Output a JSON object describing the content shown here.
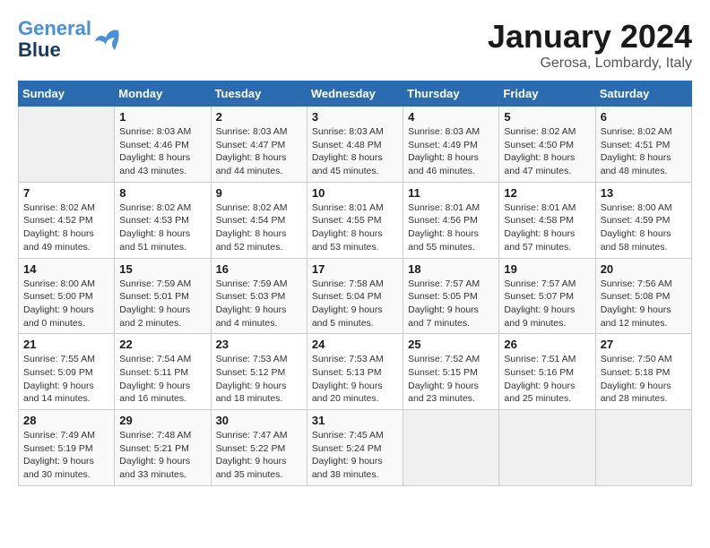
{
  "header": {
    "logo": {
      "line1": "General",
      "line2": "Blue"
    },
    "title": "January 2024",
    "subtitle": "Gerosa, Lombardy, Italy"
  },
  "weekdays": [
    "Sunday",
    "Monday",
    "Tuesday",
    "Wednesday",
    "Thursday",
    "Friday",
    "Saturday"
  ],
  "weeks": [
    [
      {
        "day": "",
        "info": ""
      },
      {
        "day": "1",
        "info": "Sunrise: 8:03 AM\nSunset: 4:46 PM\nDaylight: 8 hours\nand 43 minutes."
      },
      {
        "day": "2",
        "info": "Sunrise: 8:03 AM\nSunset: 4:47 PM\nDaylight: 8 hours\nand 44 minutes."
      },
      {
        "day": "3",
        "info": "Sunrise: 8:03 AM\nSunset: 4:48 PM\nDaylight: 8 hours\nand 45 minutes."
      },
      {
        "day": "4",
        "info": "Sunrise: 8:03 AM\nSunset: 4:49 PM\nDaylight: 8 hours\nand 46 minutes."
      },
      {
        "day": "5",
        "info": "Sunrise: 8:02 AM\nSunset: 4:50 PM\nDaylight: 8 hours\nand 47 minutes."
      },
      {
        "day": "6",
        "info": "Sunrise: 8:02 AM\nSunset: 4:51 PM\nDaylight: 8 hours\nand 48 minutes."
      }
    ],
    [
      {
        "day": "7",
        "info": "Sunrise: 8:02 AM\nSunset: 4:52 PM\nDaylight: 8 hours\nand 49 minutes."
      },
      {
        "day": "8",
        "info": "Sunrise: 8:02 AM\nSunset: 4:53 PM\nDaylight: 8 hours\nand 51 minutes."
      },
      {
        "day": "9",
        "info": "Sunrise: 8:02 AM\nSunset: 4:54 PM\nDaylight: 8 hours\nand 52 minutes."
      },
      {
        "day": "10",
        "info": "Sunrise: 8:01 AM\nSunset: 4:55 PM\nDaylight: 8 hours\nand 53 minutes."
      },
      {
        "day": "11",
        "info": "Sunrise: 8:01 AM\nSunset: 4:56 PM\nDaylight: 8 hours\nand 55 minutes."
      },
      {
        "day": "12",
        "info": "Sunrise: 8:01 AM\nSunset: 4:58 PM\nDaylight: 8 hours\nand 57 minutes."
      },
      {
        "day": "13",
        "info": "Sunrise: 8:00 AM\nSunset: 4:59 PM\nDaylight: 8 hours\nand 58 minutes."
      }
    ],
    [
      {
        "day": "14",
        "info": "Sunrise: 8:00 AM\nSunset: 5:00 PM\nDaylight: 9 hours\nand 0 minutes."
      },
      {
        "day": "15",
        "info": "Sunrise: 7:59 AM\nSunset: 5:01 PM\nDaylight: 9 hours\nand 2 minutes."
      },
      {
        "day": "16",
        "info": "Sunrise: 7:59 AM\nSunset: 5:03 PM\nDaylight: 9 hours\nand 4 minutes."
      },
      {
        "day": "17",
        "info": "Sunrise: 7:58 AM\nSunset: 5:04 PM\nDaylight: 9 hours\nand 5 minutes."
      },
      {
        "day": "18",
        "info": "Sunrise: 7:57 AM\nSunset: 5:05 PM\nDaylight: 9 hours\nand 7 minutes."
      },
      {
        "day": "19",
        "info": "Sunrise: 7:57 AM\nSunset: 5:07 PM\nDaylight: 9 hours\nand 9 minutes."
      },
      {
        "day": "20",
        "info": "Sunrise: 7:56 AM\nSunset: 5:08 PM\nDaylight: 9 hours\nand 12 minutes."
      }
    ],
    [
      {
        "day": "21",
        "info": "Sunrise: 7:55 AM\nSunset: 5:09 PM\nDaylight: 9 hours\nand 14 minutes."
      },
      {
        "day": "22",
        "info": "Sunrise: 7:54 AM\nSunset: 5:11 PM\nDaylight: 9 hours\nand 16 minutes."
      },
      {
        "day": "23",
        "info": "Sunrise: 7:53 AM\nSunset: 5:12 PM\nDaylight: 9 hours\nand 18 minutes."
      },
      {
        "day": "24",
        "info": "Sunrise: 7:53 AM\nSunset: 5:13 PM\nDaylight: 9 hours\nand 20 minutes."
      },
      {
        "day": "25",
        "info": "Sunrise: 7:52 AM\nSunset: 5:15 PM\nDaylight: 9 hours\nand 23 minutes."
      },
      {
        "day": "26",
        "info": "Sunrise: 7:51 AM\nSunset: 5:16 PM\nDaylight: 9 hours\nand 25 minutes."
      },
      {
        "day": "27",
        "info": "Sunrise: 7:50 AM\nSunset: 5:18 PM\nDaylight: 9 hours\nand 28 minutes."
      }
    ],
    [
      {
        "day": "28",
        "info": "Sunrise: 7:49 AM\nSunset: 5:19 PM\nDaylight: 9 hours\nand 30 minutes."
      },
      {
        "day": "29",
        "info": "Sunrise: 7:48 AM\nSunset: 5:21 PM\nDaylight: 9 hours\nand 33 minutes."
      },
      {
        "day": "30",
        "info": "Sunrise: 7:47 AM\nSunset: 5:22 PM\nDaylight: 9 hours\nand 35 minutes."
      },
      {
        "day": "31",
        "info": "Sunrise: 7:45 AM\nSunset: 5:24 PM\nDaylight: 9 hours\nand 38 minutes."
      },
      {
        "day": "",
        "info": ""
      },
      {
        "day": "",
        "info": ""
      },
      {
        "day": "",
        "info": ""
      }
    ]
  ]
}
